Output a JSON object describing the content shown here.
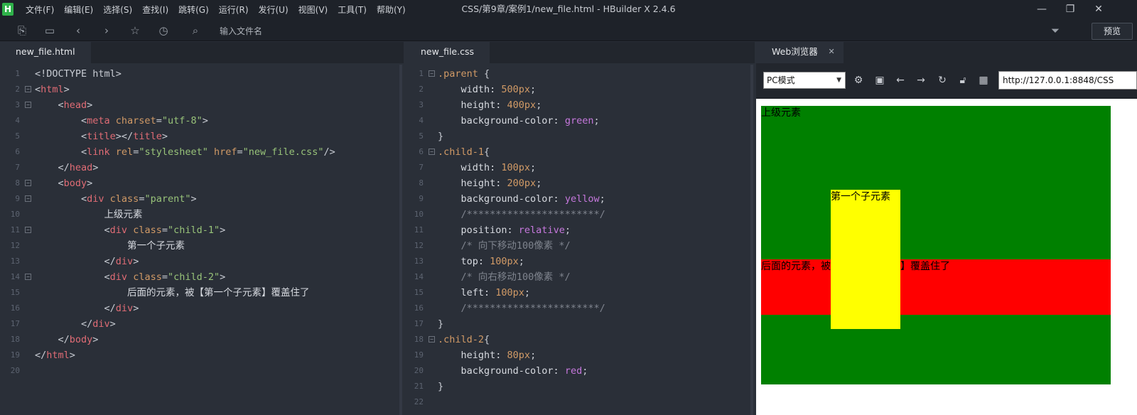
{
  "window": {
    "logo": "H",
    "title": "CSS/第9章/案例1/new_file.html - HBuilder X 2.4.6",
    "minimize": "—",
    "restore": "❐",
    "close": "✕"
  },
  "menu": [
    "文件(F)",
    "编辑(E)",
    "选择(S)",
    "查找(I)",
    "跳转(G)",
    "运行(R)",
    "发行(U)",
    "视图(V)",
    "工具(T)",
    "帮助(Y)"
  ],
  "toolbar": {
    "file_search_placeholder": "输入文件名",
    "preview_label": "预览"
  },
  "editor_html": {
    "tab": "new_file.html",
    "lines": [
      {
        "n": "1",
        "fold": "",
        "parts": [
          [
            "punc",
            "<!DOCTYPE html>"
          ]
        ]
      },
      {
        "n": "2",
        "fold": "⊟",
        "parts": [
          [
            "punc",
            "<"
          ],
          [
            "tag",
            "html"
          ],
          [
            "punc",
            ">"
          ]
        ]
      },
      {
        "n": "3",
        "fold": "⊟",
        "parts": [
          [
            "punc",
            "    <"
          ],
          [
            "tag",
            "head"
          ],
          [
            "punc",
            ">"
          ]
        ]
      },
      {
        "n": "4",
        "fold": "",
        "parts": [
          [
            "punc",
            "        <"
          ],
          [
            "tag",
            "meta "
          ],
          [
            "attr",
            "charset"
          ],
          [
            "punc",
            "="
          ],
          [
            "str",
            "\"utf-8\""
          ],
          [
            "punc",
            ">"
          ]
        ]
      },
      {
        "n": "5",
        "fold": "",
        "parts": [
          [
            "punc",
            "        <"
          ],
          [
            "tag",
            "title"
          ],
          [
            "punc",
            "></"
          ],
          [
            "tag",
            "title"
          ],
          [
            "punc",
            ">"
          ]
        ]
      },
      {
        "n": "6",
        "fold": "",
        "parts": [
          [
            "punc",
            "        <"
          ],
          [
            "tag",
            "link "
          ],
          [
            "attr",
            "rel"
          ],
          [
            "punc",
            "="
          ],
          [
            "str",
            "\"stylesheet\" "
          ],
          [
            "attr",
            "href"
          ],
          [
            "punc",
            "="
          ],
          [
            "str",
            "\"new_file.css\""
          ],
          [
            "punc",
            "/>"
          ]
        ]
      },
      {
        "n": "7",
        "fold": "",
        "parts": [
          [
            "punc",
            "    </"
          ],
          [
            "tag",
            "head"
          ],
          [
            "punc",
            ">"
          ]
        ]
      },
      {
        "n": "8",
        "fold": "⊟",
        "parts": [
          [
            "punc",
            "    <"
          ],
          [
            "tag",
            "body"
          ],
          [
            "punc",
            ">"
          ]
        ]
      },
      {
        "n": "9",
        "fold": "⊟",
        "parts": [
          [
            "punc",
            "        <"
          ],
          [
            "tag",
            "div "
          ],
          [
            "attr",
            "class"
          ],
          [
            "punc",
            "="
          ],
          [
            "str",
            "\"parent\""
          ],
          [
            "punc",
            ">"
          ]
        ]
      },
      {
        "n": "10",
        "fold": "",
        "parts": [
          [
            "text",
            "            上级元素"
          ]
        ]
      },
      {
        "n": "11",
        "fold": "⊟",
        "parts": [
          [
            "punc",
            "            <"
          ],
          [
            "tag",
            "div "
          ],
          [
            "attr",
            "class"
          ],
          [
            "punc",
            "="
          ],
          [
            "str",
            "\"child-1\""
          ],
          [
            "punc",
            ">"
          ]
        ]
      },
      {
        "n": "12",
        "fold": "",
        "parts": [
          [
            "text",
            "                第一个子元素"
          ]
        ]
      },
      {
        "n": "13",
        "fold": "",
        "parts": [
          [
            "punc",
            "            </"
          ],
          [
            "tag",
            "div"
          ],
          [
            "punc",
            ">"
          ]
        ]
      },
      {
        "n": "14",
        "fold": "⊟",
        "parts": [
          [
            "punc",
            "            <"
          ],
          [
            "tag",
            "div "
          ],
          [
            "attr",
            "class"
          ],
          [
            "punc",
            "="
          ],
          [
            "str",
            "\"child-2\""
          ],
          [
            "punc",
            ">"
          ]
        ]
      },
      {
        "n": "15",
        "fold": "",
        "parts": [
          [
            "text",
            "                后面的元素，被【第一个子元素】覆盖住了"
          ]
        ]
      },
      {
        "n": "16",
        "fold": "",
        "parts": [
          [
            "punc",
            "            </"
          ],
          [
            "tag",
            "div"
          ],
          [
            "punc",
            ">"
          ]
        ]
      },
      {
        "n": "17",
        "fold": "",
        "parts": [
          [
            "punc",
            "        </"
          ],
          [
            "tag",
            "div"
          ],
          [
            "punc",
            ">"
          ]
        ]
      },
      {
        "n": "18",
        "fold": "",
        "parts": [
          [
            "punc",
            "    </"
          ],
          [
            "tag",
            "body"
          ],
          [
            "punc",
            ">"
          ]
        ]
      },
      {
        "n": "19",
        "fold": "",
        "parts": [
          [
            "punc",
            "</"
          ],
          [
            "tag",
            "html"
          ],
          [
            "punc",
            ">"
          ]
        ]
      },
      {
        "n": "20",
        "fold": "",
        "parts": []
      }
    ]
  },
  "editor_css": {
    "tab": "new_file.css",
    "lines": [
      {
        "n": "1",
        "fold": "⊟",
        "parts": [
          [
            "sel",
            ".parent "
          ],
          [
            "punc",
            "{"
          ]
        ]
      },
      {
        "n": "2",
        "fold": "",
        "parts": [
          [
            "prop",
            "    width: "
          ],
          [
            "num",
            "500px"
          ],
          [
            "punc",
            ";"
          ]
        ]
      },
      {
        "n": "3",
        "fold": "",
        "parts": [
          [
            "prop",
            "    height: "
          ],
          [
            "num",
            "400px"
          ],
          [
            "punc",
            ";"
          ]
        ]
      },
      {
        "n": "4",
        "fold": "",
        "parts": [
          [
            "prop",
            "    background-color: "
          ],
          [
            "kw",
            "green"
          ],
          [
            "punc",
            ";"
          ]
        ]
      },
      {
        "n": "5",
        "fold": "",
        "parts": [
          [
            "punc",
            "}"
          ]
        ]
      },
      {
        "n": "6",
        "fold": "⊟",
        "parts": [
          [
            "sel",
            ".child-1"
          ],
          [
            "punc",
            "{"
          ]
        ]
      },
      {
        "n": "7",
        "fold": "",
        "parts": [
          [
            "prop",
            "    width: "
          ],
          [
            "num",
            "100px"
          ],
          [
            "punc",
            ";"
          ]
        ]
      },
      {
        "n": "8",
        "fold": "",
        "parts": [
          [
            "prop",
            "    height: "
          ],
          [
            "num",
            "200px"
          ],
          [
            "punc",
            ";"
          ]
        ]
      },
      {
        "n": "9",
        "fold": "",
        "parts": [
          [
            "prop",
            "    background-color: "
          ],
          [
            "kw",
            "yellow"
          ],
          [
            "punc",
            ";"
          ]
        ]
      },
      {
        "n": "10",
        "fold": "",
        "parts": [
          [
            "cmt",
            "    /***********************/"
          ]
        ]
      },
      {
        "n": "11",
        "fold": "",
        "parts": [
          [
            "prop",
            "    position: "
          ],
          [
            "kw",
            "relative"
          ],
          [
            "punc",
            ";"
          ]
        ]
      },
      {
        "n": "12",
        "fold": "",
        "parts": [
          [
            "cmt",
            "    /* 向下移动100像素 */"
          ]
        ]
      },
      {
        "n": "13",
        "fold": "",
        "parts": [
          [
            "prop",
            "    top: "
          ],
          [
            "num",
            "100px"
          ],
          [
            "punc",
            ";"
          ]
        ]
      },
      {
        "n": "14",
        "fold": "",
        "parts": [
          [
            "cmt",
            "    /* 向右移动100像素 */"
          ]
        ]
      },
      {
        "n": "15",
        "fold": "",
        "parts": [
          [
            "prop",
            "    left: "
          ],
          [
            "num",
            "100px"
          ],
          [
            "punc",
            ";"
          ]
        ]
      },
      {
        "n": "16",
        "fold": "",
        "parts": [
          [
            "cmt",
            "    /***********************/"
          ]
        ]
      },
      {
        "n": "17",
        "fold": "",
        "parts": [
          [
            "punc",
            "}"
          ]
        ]
      },
      {
        "n": "18",
        "fold": "⊟",
        "parts": [
          [
            "sel",
            ".child-2"
          ],
          [
            "punc",
            "{"
          ]
        ]
      },
      {
        "n": "19",
        "fold": "",
        "parts": [
          [
            "prop",
            "    height: "
          ],
          [
            "num",
            "80px"
          ],
          [
            "punc",
            ";"
          ]
        ]
      },
      {
        "n": "20",
        "fold": "",
        "parts": [
          [
            "prop",
            "    background-color: "
          ],
          [
            "kw",
            "red"
          ],
          [
            "punc",
            ";"
          ]
        ]
      },
      {
        "n": "21",
        "fold": "",
        "parts": [
          [
            "punc",
            "}"
          ]
        ]
      },
      {
        "n": "22",
        "fold": "",
        "parts": []
      }
    ]
  },
  "browser": {
    "tab": "Web浏览器",
    "tab_close": "✕",
    "mode": "PC模式",
    "url": "http://127.0.0.1:8848/CSS",
    "preview": {
      "parent_text": "上级元素",
      "child1_text": "第一个子元素",
      "child2_text": "后面的元素，被【第一个子元素】覆盖住了"
    }
  },
  "colors": {
    "parent": "#008000",
    "child1": "#ffff00",
    "child2": "#ff0000"
  }
}
